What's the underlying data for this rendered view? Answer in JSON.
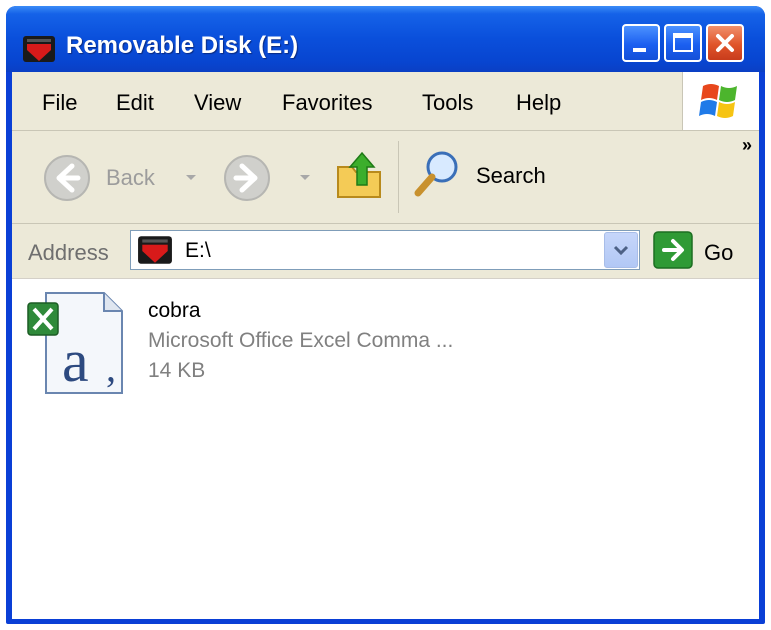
{
  "window": {
    "title": "Removable Disk (E:)"
  },
  "menu": {
    "items": [
      "File",
      "Edit",
      "View",
      "Favorites",
      "Tools",
      "Help"
    ]
  },
  "toolbar": {
    "back_label": "Back",
    "search_label": "Search",
    "more_label": "»"
  },
  "address": {
    "label": "Address",
    "value": "E:\\",
    "go_label": "Go"
  },
  "files": [
    {
      "name": "cobra",
      "type": "Microsoft Office Excel Comma ...",
      "size": "14 KB",
      "icon": "excel-csv-file-icon"
    }
  ],
  "icons": {
    "drive": "removable-disk-icon",
    "back": "back-arrow-icon",
    "forward": "forward-arrow-icon",
    "up": "folder-up-icon",
    "search": "magnifier-icon",
    "go": "go-arrow-icon"
  },
  "colors": {
    "title_bar": "#0a4fdb",
    "close_button": "#e0542a",
    "menu_bg": "#ece9d8",
    "go_green": "#2f9a35"
  }
}
